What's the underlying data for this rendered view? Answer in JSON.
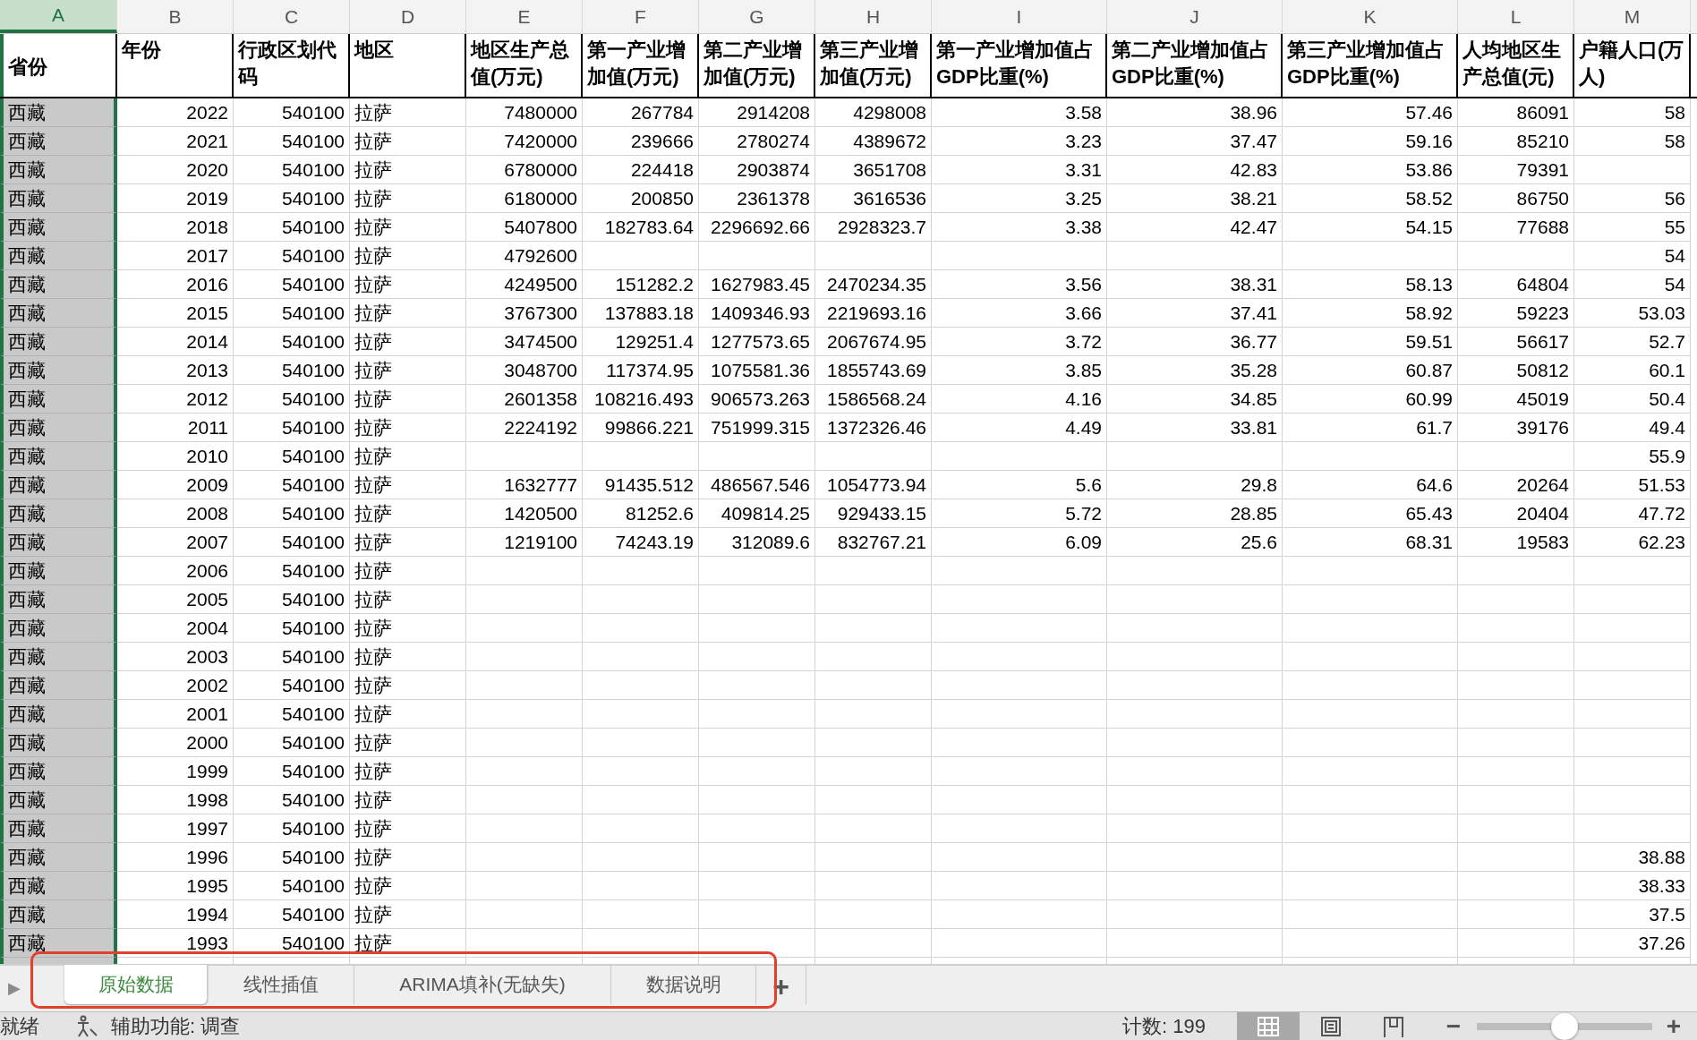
{
  "column_headers": [
    {
      "label": "A",
      "selected": true
    },
    {
      "label": "B",
      "selected": false
    },
    {
      "label": "C",
      "selected": false
    },
    {
      "label": "D",
      "selected": false
    },
    {
      "label": "E",
      "selected": false
    },
    {
      "label": "F",
      "selected": false
    },
    {
      "label": "G",
      "selected": false
    },
    {
      "label": "H",
      "selected": false
    },
    {
      "label": "I",
      "selected": false
    },
    {
      "label": "J",
      "selected": false
    },
    {
      "label": "K",
      "selected": false
    },
    {
      "label": "L",
      "selected": false
    },
    {
      "label": "M",
      "selected": false
    }
  ],
  "table": {
    "columns": [
      {
        "label": "省份",
        "kind": "text"
      },
      {
        "label": "年份",
        "kind": "number"
      },
      {
        "label": "行政区划代码",
        "kind": "number"
      },
      {
        "label": "地区",
        "kind": "text"
      },
      {
        "label": "地区生产总值(万元)",
        "kind": "number"
      },
      {
        "label": "第一产业增加值(万元)",
        "kind": "number"
      },
      {
        "label": "第二产业增加值(万元)",
        "kind": "number"
      },
      {
        "label": "第三产业增加值(万元)",
        "kind": "number"
      },
      {
        "label": "第一产业增加值占GDP比重(%)",
        "kind": "number"
      },
      {
        "label": "第二产业增加值占GDP比重(%)",
        "kind": "number"
      },
      {
        "label": "第三产业增加值占GDP比重(%)",
        "kind": "number"
      },
      {
        "label": "人均地区生产总值(元)",
        "kind": "number"
      },
      {
        "label": "户籍人口(万人)",
        "kind": "number"
      }
    ],
    "rows": [
      [
        "西藏",
        "2022",
        "540100",
        "拉萨",
        "7480000",
        "267784",
        "2914208",
        "4298008",
        "3.58",
        "38.96",
        "57.46",
        "86091",
        "58"
      ],
      [
        "西藏",
        "2021",
        "540100",
        "拉萨",
        "7420000",
        "239666",
        "2780274",
        "4389672",
        "3.23",
        "37.47",
        "59.16",
        "85210",
        "58"
      ],
      [
        "西藏",
        "2020",
        "540100",
        "拉萨",
        "6780000",
        "224418",
        "2903874",
        "3651708",
        "3.31",
        "42.83",
        "53.86",
        "79391",
        null
      ],
      [
        "西藏",
        "2019",
        "540100",
        "拉萨",
        "6180000",
        "200850",
        "2361378",
        "3616536",
        "3.25",
        "38.21",
        "58.52",
        "86750",
        "56"
      ],
      [
        "西藏",
        "2018",
        "540100",
        "拉萨",
        "5407800",
        "182783.64",
        "2296692.66",
        "2928323.7",
        "3.38",
        "42.47",
        "54.15",
        "77688",
        "55"
      ],
      [
        "西藏",
        "2017",
        "540100",
        "拉萨",
        "4792600",
        null,
        null,
        null,
        null,
        null,
        null,
        null,
        "54"
      ],
      [
        "西藏",
        "2016",
        "540100",
        "拉萨",
        "4249500",
        "151282.2",
        "1627983.45",
        "2470234.35",
        "3.56",
        "38.31",
        "58.13",
        "64804",
        "54"
      ],
      [
        "西藏",
        "2015",
        "540100",
        "拉萨",
        "3767300",
        "137883.18",
        "1409346.93",
        "2219693.16",
        "3.66",
        "37.41",
        "58.92",
        "59223",
        "53.03"
      ],
      [
        "西藏",
        "2014",
        "540100",
        "拉萨",
        "3474500",
        "129251.4",
        "1277573.65",
        "2067674.95",
        "3.72",
        "36.77",
        "59.51",
        "56617",
        "52.7"
      ],
      [
        "西藏",
        "2013",
        "540100",
        "拉萨",
        "3048700",
        "117374.95",
        "1075581.36",
        "1855743.69",
        "3.85",
        "35.28",
        "60.87",
        "50812",
        "60.1"
      ],
      [
        "西藏",
        "2012",
        "540100",
        "拉萨",
        "2601358",
        "108216.493",
        "906573.263",
        "1586568.24",
        "4.16",
        "34.85",
        "60.99",
        "45019",
        "50.4"
      ],
      [
        "西藏",
        "2011",
        "540100",
        "拉萨",
        "2224192",
        "99866.221",
        "751999.315",
        "1372326.46",
        "4.49",
        "33.81",
        "61.7",
        "39176",
        "49.4"
      ],
      [
        "西藏",
        "2010",
        "540100",
        "拉萨",
        null,
        null,
        null,
        null,
        null,
        null,
        null,
        null,
        "55.9"
      ],
      [
        "西藏",
        "2009",
        "540100",
        "拉萨",
        "1632777",
        "91435.512",
        "486567.546",
        "1054773.94",
        "5.6",
        "29.8",
        "64.6",
        "20264",
        "51.53"
      ],
      [
        "西藏",
        "2008",
        "540100",
        "拉萨",
        "1420500",
        "81252.6",
        "409814.25",
        "929433.15",
        "5.72",
        "28.85",
        "65.43",
        "20404",
        "47.72"
      ],
      [
        "西藏",
        "2007",
        "540100",
        "拉萨",
        "1219100",
        "74243.19",
        "312089.6",
        "832767.21",
        "6.09",
        "25.6",
        "68.31",
        "19583",
        "62.23"
      ],
      [
        "西藏",
        "2006",
        "540100",
        "拉萨",
        null,
        null,
        null,
        null,
        null,
        null,
        null,
        null,
        null
      ],
      [
        "西藏",
        "2005",
        "540100",
        "拉萨",
        null,
        null,
        null,
        null,
        null,
        null,
        null,
        null,
        null
      ],
      [
        "西藏",
        "2004",
        "540100",
        "拉萨",
        null,
        null,
        null,
        null,
        null,
        null,
        null,
        null,
        null
      ],
      [
        "西藏",
        "2003",
        "540100",
        "拉萨",
        null,
        null,
        null,
        null,
        null,
        null,
        null,
        null,
        null
      ],
      [
        "西藏",
        "2002",
        "540100",
        "拉萨",
        null,
        null,
        null,
        null,
        null,
        null,
        null,
        null,
        null
      ],
      [
        "西藏",
        "2001",
        "540100",
        "拉萨",
        null,
        null,
        null,
        null,
        null,
        null,
        null,
        null,
        null
      ],
      [
        "西藏",
        "2000",
        "540100",
        "拉萨",
        null,
        null,
        null,
        null,
        null,
        null,
        null,
        null,
        null
      ],
      [
        "西藏",
        "1999",
        "540100",
        "拉萨",
        null,
        null,
        null,
        null,
        null,
        null,
        null,
        null,
        null
      ],
      [
        "西藏",
        "1998",
        "540100",
        "拉萨",
        null,
        null,
        null,
        null,
        null,
        null,
        null,
        null,
        null
      ],
      [
        "西藏",
        "1997",
        "540100",
        "拉萨",
        null,
        null,
        null,
        null,
        null,
        null,
        null,
        null,
        null
      ],
      [
        "西藏",
        "1996",
        "540100",
        "拉萨",
        null,
        null,
        null,
        null,
        null,
        null,
        null,
        null,
        "38.88"
      ],
      [
        "西藏",
        "1995",
        "540100",
        "拉萨",
        null,
        null,
        null,
        null,
        null,
        null,
        null,
        null,
        "38.33"
      ],
      [
        "西藏",
        "1994",
        "540100",
        "拉萨",
        null,
        null,
        null,
        null,
        null,
        null,
        null,
        null,
        "37.5"
      ],
      [
        "西藏",
        "1993",
        "540100",
        "拉萨",
        null,
        null,
        null,
        null,
        null,
        null,
        null,
        null,
        "37.26"
      ]
    ]
  },
  "sheet_nav": "▶",
  "sheet_tabs": [
    {
      "label": "原始数据",
      "selected": true
    },
    {
      "label": "线性插值",
      "selected": false
    },
    {
      "label": "ARIMA填补(无缺失)",
      "selected": false
    },
    {
      "label": "数据说明",
      "selected": false
    }
  ],
  "add_sheet": "+",
  "status_bar": {
    "ready": "就绪",
    "accessibility": "辅助功能: 调查",
    "count": "计数: 199",
    "views": [
      {
        "kind": "normal",
        "selected": true
      },
      {
        "kind": "page_layout",
        "selected": false
      },
      {
        "kind": "page_break",
        "selected": false
      }
    ],
    "zoom": {
      "minus": "−",
      "plus": "+",
      "level": 0.5
    }
  }
}
